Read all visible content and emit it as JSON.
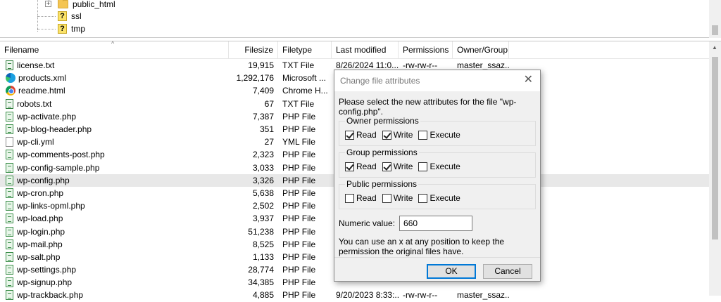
{
  "tree": {
    "items": [
      {
        "label": "public_html",
        "icon": "folder-icon",
        "expander": "+"
      },
      {
        "label": "ssl",
        "icon": "unknown-icon"
      },
      {
        "label": "tmp",
        "icon": "unknown-icon"
      }
    ]
  },
  "columns": {
    "filename": "Filename",
    "filesize": "Filesize",
    "filetype": "Filetype",
    "last_modified": "Last modified",
    "permissions": "Permissions",
    "owner_group": "Owner/Group"
  },
  "files": [
    {
      "name": "license.txt",
      "icon": "txt",
      "size": "19,915",
      "type": "TXT File",
      "modified": "8/26/2024 11:0...",
      "perm": "-rw-rw-r--",
      "owner": "master_ssaz..."
    },
    {
      "name": "products.xml",
      "icon": "edge",
      "size": "1,292,176",
      "type": "Microsoft ...",
      "modified": "",
      "perm": "",
      "owner": ""
    },
    {
      "name": "readme.html",
      "icon": "chrome",
      "size": "7,409",
      "type": "Chrome H...",
      "modified": "",
      "perm": "",
      "owner": ""
    },
    {
      "name": "robots.txt",
      "icon": "txt",
      "size": "67",
      "type": "TXT File",
      "modified": "",
      "perm": "",
      "owner": ""
    },
    {
      "name": "wp-activate.php",
      "icon": "php",
      "size": "7,387",
      "type": "PHP File",
      "modified": "",
      "perm": "",
      "owner": ""
    },
    {
      "name": "wp-blog-header.php",
      "icon": "php",
      "size": "351",
      "type": "PHP File",
      "modified": "",
      "perm": "",
      "owner": ""
    },
    {
      "name": "wp-cli.yml",
      "icon": "yml",
      "size": "27",
      "type": "YML File",
      "modified": "",
      "perm": "",
      "owner": ""
    },
    {
      "name": "wp-comments-post.php",
      "icon": "php",
      "size": "2,323",
      "type": "PHP File",
      "modified": "",
      "perm": "",
      "owner": ""
    },
    {
      "name": "wp-config-sample.php",
      "icon": "php",
      "size": "3,033",
      "type": "PHP File",
      "modified": "",
      "perm": "",
      "owner": ""
    },
    {
      "name": "wp-config.php",
      "icon": "php",
      "size": "3,326",
      "type": "PHP File",
      "modified": "",
      "perm": "",
      "owner": "",
      "selected": true
    },
    {
      "name": "wp-cron.php",
      "icon": "php",
      "size": "5,638",
      "type": "PHP File",
      "modified": "",
      "perm": "",
      "owner": ""
    },
    {
      "name": "wp-links-opml.php",
      "icon": "php",
      "size": "2,502",
      "type": "PHP File",
      "modified": "",
      "perm": "",
      "owner": ""
    },
    {
      "name": "wp-load.php",
      "icon": "php",
      "size": "3,937",
      "type": "PHP File",
      "modified": "",
      "perm": "",
      "owner": ""
    },
    {
      "name": "wp-login.php",
      "icon": "php",
      "size": "51,238",
      "type": "PHP File",
      "modified": "",
      "perm": "",
      "owner": ""
    },
    {
      "name": "wp-mail.php",
      "icon": "php",
      "size": "8,525",
      "type": "PHP File",
      "modified": "",
      "perm": "",
      "owner": ""
    },
    {
      "name": "wp-salt.php",
      "icon": "php",
      "size": "1,133",
      "type": "PHP File",
      "modified": "",
      "perm": "",
      "owner": ""
    },
    {
      "name": "wp-settings.php",
      "icon": "php",
      "size": "28,774",
      "type": "PHP File",
      "modified": "",
      "perm": "",
      "owner": ""
    },
    {
      "name": "wp-signup.php",
      "icon": "php",
      "size": "34,385",
      "type": "PHP File",
      "modified": "",
      "perm": "",
      "owner": ""
    },
    {
      "name": "wp-trackback.php",
      "icon": "php",
      "size": "4,885",
      "type": "PHP File",
      "modified": "9/20/2023 8:33:...",
      "perm": "-rw-rw-r--",
      "owner": "master_ssaz..."
    }
  ],
  "dialog": {
    "title": "Change file attributes",
    "close": "✕",
    "description": "Please select the new attributes for the file \"wp-config.php\".",
    "groups": [
      {
        "label": "Owner permissions",
        "read": true,
        "write": true,
        "execute": false
      },
      {
        "label": "Group permissions",
        "read": true,
        "write": true,
        "execute": false
      },
      {
        "label": "Public permissions",
        "read": false,
        "write": false,
        "execute": false
      }
    ],
    "check_labels": {
      "read": "Read",
      "write": "Write",
      "execute": "Execute"
    },
    "numeric_label": "Numeric value:",
    "numeric_value": "660",
    "note": "You can use an x at any position to keep the permission the original files have.",
    "ok": "OK",
    "cancel": "Cancel"
  }
}
